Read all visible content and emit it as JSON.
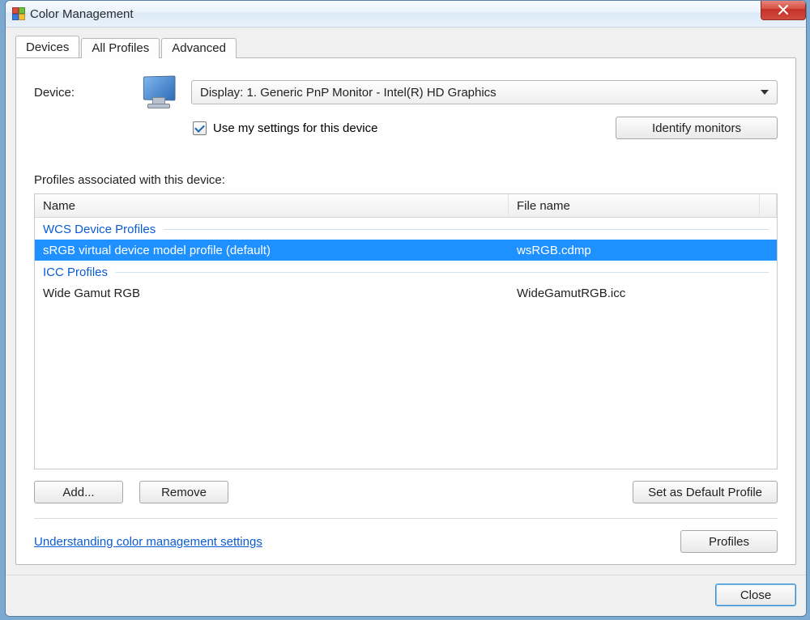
{
  "window": {
    "title": "Color Management"
  },
  "tabs": {
    "devices": "Devices",
    "all_profiles": "All Profiles",
    "advanced": "Advanced"
  },
  "device": {
    "label": "Device:",
    "selected": "Display: 1. Generic PnP Monitor - Intel(R) HD Graphics",
    "use_settings_label": "Use my settings for this device",
    "use_settings_checked": true,
    "identify_button": "Identify monitors"
  },
  "profiles": {
    "section_label": "Profiles associated with this device:",
    "columns": {
      "name": "Name",
      "filename": "File name"
    },
    "groups": [
      {
        "title": "WCS Device Profiles",
        "rows": [
          {
            "name": "sRGB virtual device model profile (default)",
            "file": "wsRGB.cdmp",
            "selected": true
          }
        ]
      },
      {
        "title": "ICC Profiles",
        "rows": [
          {
            "name": "Wide Gamut RGB",
            "file": "WideGamutRGB.icc",
            "selected": false
          }
        ]
      }
    ],
    "buttons": {
      "add": "Add...",
      "remove": "Remove",
      "set_default": "Set as Default Profile"
    }
  },
  "footer": {
    "link": "Understanding color management settings",
    "profiles_button": "Profiles"
  },
  "bottom": {
    "close": "Close"
  }
}
